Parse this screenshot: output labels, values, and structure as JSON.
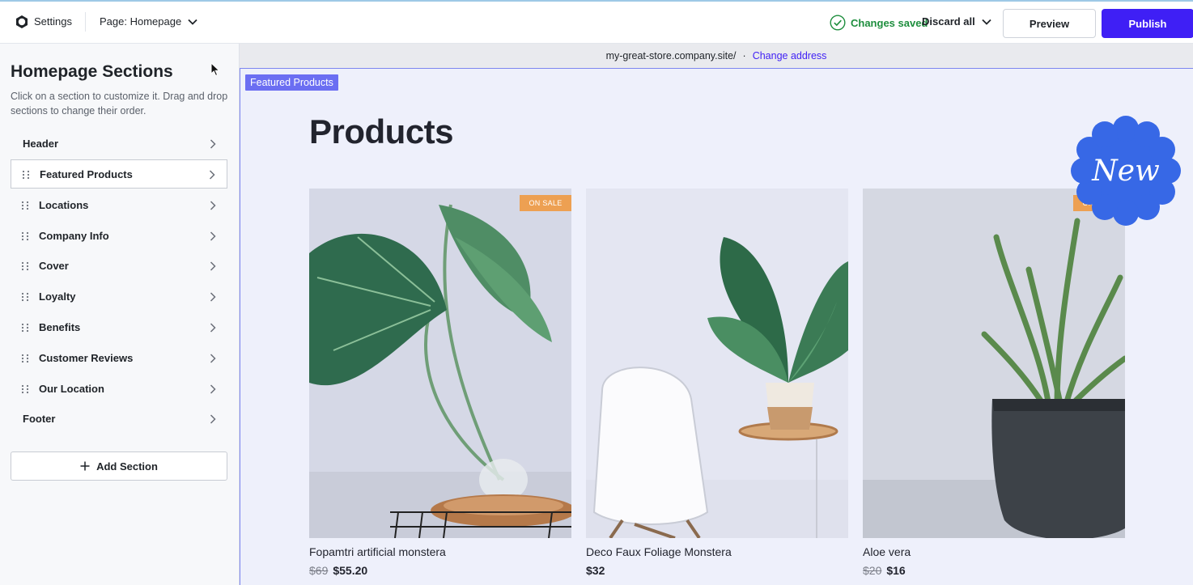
{
  "topbar": {
    "app_title": "Settings",
    "page_selector": "Page: Homepage",
    "status": "Changes saved",
    "discard_label": "Discard all",
    "preview_label": "Preview",
    "publish_label": "Publish",
    "colors": {
      "publish": "#3f1ff5",
      "saved": "#1e8e3e"
    }
  },
  "sidebar": {
    "title": "Homepage Sections",
    "description": "Click on a section to customize it. Drag and drop sections to change their order.",
    "items": [
      {
        "label": "Header",
        "draggable": false,
        "selected": false
      },
      {
        "label": "Featured Products",
        "draggable": true,
        "selected": true
      },
      {
        "label": "Locations",
        "draggable": true,
        "selected": false
      },
      {
        "label": "Company Info",
        "draggable": true,
        "selected": false
      },
      {
        "label": "Cover",
        "draggable": true,
        "selected": false
      },
      {
        "label": "Loyalty",
        "draggable": true,
        "selected": false
      },
      {
        "label": "Benefits",
        "draggable": true,
        "selected": false
      },
      {
        "label": "Customer Reviews",
        "draggable": true,
        "selected": false
      },
      {
        "label": "Our Location",
        "draggable": true,
        "selected": false
      },
      {
        "label": "Footer",
        "draggable": false,
        "selected": false
      }
    ],
    "add_section_label": "Add Section"
  },
  "preview": {
    "address": "my-great-store.company.site/",
    "separator": "·",
    "change_address_label": "Change address",
    "section_tag": "Featured Products",
    "heading": "Products",
    "new_badge": "New",
    "products": [
      {
        "name": "Fopamtri artificial monstera",
        "old_price": "$69",
        "price": "$55.20",
        "badge": "ON SALE",
        "image": "monstera-in-glass-vase-image"
      },
      {
        "name": "Deco Faux Foliage Monstera",
        "old_price": "",
        "price": "$32",
        "badge": "",
        "image": "white-chair-and-potted-monstera-image"
      },
      {
        "name": "Aloe vera",
        "old_price": "$20",
        "price": "$16",
        "badge": "ON SALE",
        "image": "aloe-vera-in-dark-pot-image"
      }
    ]
  }
}
